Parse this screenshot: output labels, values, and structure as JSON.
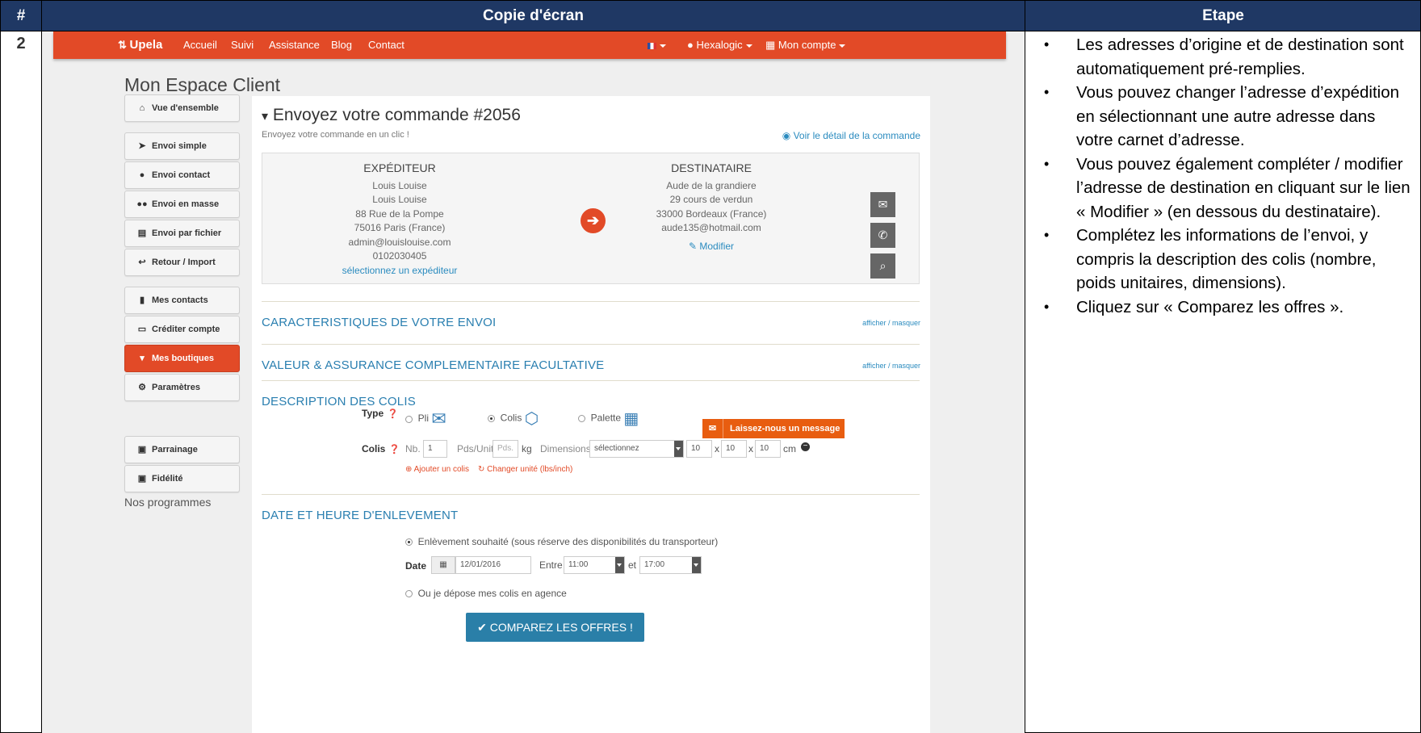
{
  "doc": {
    "col_num_header": "#",
    "col_screenshot_header": "Copie d'écran",
    "col_step_header": "Etape",
    "row_number": "2"
  },
  "steps": [
    "Les adresses d’origine et de destination sont automatiquement pré-remplies.",
    "Vous pouvez changer l’adresse d’expédition en sélectionnant une autre adresse dans votre carnet d’adresse.",
    "Vous pouvez également compléter / modifier l’adresse de destination en cliquant sur le lien « Modifier » (en dessous du destinataire).",
    "Complétez les informations de l’envoi, y compris la description des colis (nombre, poids unitaires, dimensions).",
    "Cliquez sur « Comparez les offres »."
  ],
  "navbar": {
    "brand": "Upela",
    "links": [
      "Accueil",
      "Suivi",
      "Assistance",
      "Blog",
      "Contact"
    ],
    "user": "Hexalogic",
    "account": "Mon compte",
    "accent": "#e24a27"
  },
  "page_title": "Mon Espace Client",
  "sidebar": {
    "items": [
      {
        "label": "Vue d'ensemble",
        "icon": "home-icon",
        "glyph": "⌂"
      },
      {
        "label": "Envoi simple",
        "icon": "send-icon",
        "glyph": "➤"
      },
      {
        "label": "Envoi contact",
        "icon": "user-icon",
        "glyph": "●"
      },
      {
        "label": "Envoi en masse",
        "icon": "users-icon",
        "glyph": "●●"
      },
      {
        "label": "Envoi par fichier",
        "icon": "file-icon",
        "glyph": "▤"
      },
      {
        "label": "Retour / Import",
        "icon": "reply-icon",
        "glyph": "↩"
      },
      {
        "label": "Mes contacts",
        "icon": "book-icon",
        "glyph": "▮"
      },
      {
        "label": "Créditer compte",
        "icon": "credit-card-icon",
        "glyph": "▭"
      },
      {
        "label": "Mes boutiques",
        "icon": "cart-icon",
        "glyph": "▾"
      },
      {
        "label": "Paramètres",
        "icon": "gears-icon",
        "glyph": "⚙"
      }
    ],
    "programs_label": "Nos programmes",
    "programs": [
      {
        "label": "Parrainage",
        "icon": "gift-icon",
        "glyph": "▣"
      },
      {
        "label": "Fidélité",
        "icon": "gift-icon",
        "glyph": "▣"
      }
    ]
  },
  "order": {
    "title": "Envoyez votre commande #2056",
    "subtitle": "Envoyez votre commande en un clic !",
    "detail_link": "Voir le détail de la commande"
  },
  "sender": {
    "title": "EXPÉDITEUR",
    "lines": [
      "Louis Louise",
      "Louis Louise",
      "88 Rue de la Pompe",
      "75016 Paris (France)",
      "admin@louislouise.com",
      "0102030405"
    ],
    "select_link": "sélectionnez un expéditeur"
  },
  "recipient": {
    "title": "DESTINATAIRE",
    "lines": [
      "Aude de la grandiere",
      "29 cours de verdun",
      "33000 Bordeaux (France)",
      "aude135@hotmail.com"
    ],
    "modify_link": "Modifier"
  },
  "sections": {
    "characteristics": "CARACTERISTIQUES DE VOTRE ENVOI",
    "insurance": "VALEUR & ASSURANCE COMPLEMENTAIRE FACULTATIVE",
    "toggle": "afficher / masquer",
    "parcels": "DESCRIPTION DES COLIS",
    "pickup": "DATE ET HEURE D'ENLEVEMENT"
  },
  "parcels": {
    "type_label": "Type",
    "types": [
      "Pli",
      "Colis",
      "Palette"
    ],
    "selected_type": "Colis",
    "colis_label": "Colis",
    "nb_label": "Nb.",
    "nb_value": "1",
    "weight_label": "Pds/Unit",
    "weight_placeholder": "Pds.",
    "weight_unit": "kg",
    "dimensions_label": "Dimensions",
    "dimensions_select": "sélectionnez",
    "dim_values": [
      "10",
      "10",
      "10"
    ],
    "dim_sep": "x",
    "dim_unit": "cm",
    "add_link": "Ajouter un colis",
    "unit_link": "Changer unité (lbs/inch)"
  },
  "pickup": {
    "option1": "Enlèvement souhaité (sous réserve des disponibilités du transporteur)",
    "date_label": "Date",
    "date_value": "12/01/2016",
    "between_label": "Entre",
    "from_time": "11:00",
    "and_label": "et",
    "to_time": "17:00",
    "option2": "Ou je dépose mes colis en agence"
  },
  "compare_button": "COMPAREZ LES OFFRES !",
  "message_tab": "Laissez-nous un message"
}
